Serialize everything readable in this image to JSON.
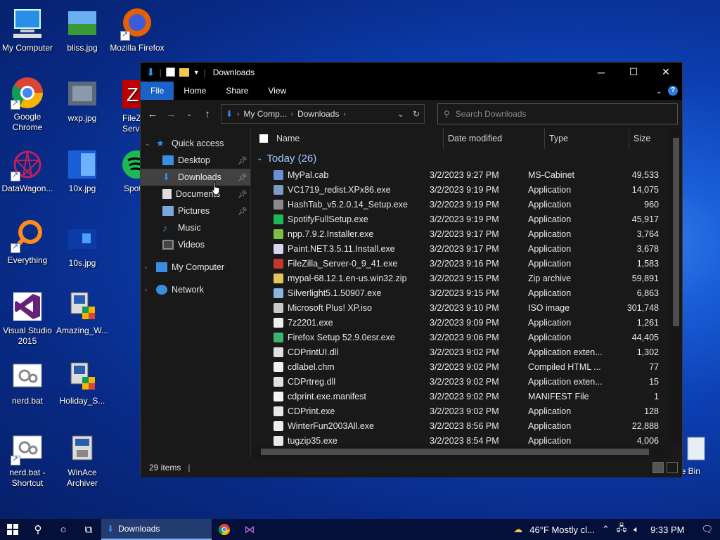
{
  "desktop": {
    "icons": [
      {
        "label": "My Computer",
        "icon": "computer-icon"
      },
      {
        "label": "bliss.jpg",
        "icon": "image-icon"
      },
      {
        "label": "Mozilla Firefox",
        "icon": "firefox-icon"
      },
      {
        "label": "Google Chrome",
        "icon": "chrome-icon"
      },
      {
        "label": "wxp.jpg",
        "icon": "image-icon"
      },
      {
        "label": "FileZ Serve",
        "icon": "filezilla-icon"
      },
      {
        "label": "DataWagon...",
        "icon": "datawagon-icon"
      },
      {
        "label": "10x.jpg",
        "icon": "image-icon"
      },
      {
        "label": "Spoti",
        "icon": "spotify-icon"
      },
      {
        "label": "Everything",
        "icon": "search-icon"
      },
      {
        "label": "10s.jpg",
        "icon": "image-icon"
      },
      {
        "label": "Visual Studio 2015",
        "icon": "visual-studio-icon"
      },
      {
        "label": "Amazing_W...",
        "icon": "installer-icon"
      },
      {
        "label": "nerd.bat",
        "icon": "gear-icon"
      },
      {
        "label": "Holiday_S...",
        "icon": "installer-icon"
      },
      {
        "label": "nerd.bat - Shortcut",
        "icon": "gear-icon"
      },
      {
        "label": "WinAce Archiver",
        "icon": "archiver-icon"
      },
      {
        "label": "cle Bin",
        "icon": "recycle-bin-icon"
      }
    ]
  },
  "window": {
    "title": "Downloads",
    "ribbon_tabs": [
      "File",
      "Home",
      "Share",
      "View"
    ],
    "breadcrumb": [
      "My Comp...",
      "Downloads"
    ],
    "search_placeholder": "Search Downloads",
    "nav": {
      "quick_access": "Quick access",
      "items": [
        "Desktop",
        "Downloads",
        "Documents",
        "Pictures",
        "Music",
        "Videos"
      ],
      "my_computer": "My Computer",
      "network": "Network"
    },
    "columns": [
      "Name",
      "Date modified",
      "Type",
      "Size"
    ],
    "group_label": "Today (26)",
    "files": [
      {
        "name": "MyPal.cab",
        "date": "3/2/2023 9:27 PM",
        "type": "MS-Cabinet",
        "size": "49,533",
        "color": "#6a8fd6"
      },
      {
        "name": "VC1719_redist.XPx86.exe",
        "date": "3/2/2023 9:19 PM",
        "type": "Application",
        "size": "14,075",
        "color": "#7e9bc4"
      },
      {
        "name": "HashTab_v5.2.0.14_Setup.exe",
        "date": "3/2/2023 9:19 PM",
        "type": "Application",
        "size": "960",
        "color": "#8a8a8a"
      },
      {
        "name": "SpotifyFullSetup.exe",
        "date": "3/2/2023 9:19 PM",
        "type": "Application",
        "size": "45,917",
        "color": "#1db954"
      },
      {
        "name": "npp.7.9.2.Installer.exe",
        "date": "3/2/2023 9:17 PM",
        "type": "Application",
        "size": "3,764",
        "color": "#7bc043"
      },
      {
        "name": "Paint.NET.3.5.11.Install.exe",
        "date": "3/2/2023 9:17 PM",
        "type": "Application",
        "size": "3,678",
        "color": "#d6d6f0"
      },
      {
        "name": "FileZilla_Server-0_9_41.exe",
        "date": "3/2/2023 9:16 PM",
        "type": "Application",
        "size": "1,583",
        "color": "#c0392b"
      },
      {
        "name": "mypal-68.12.1.en-us.win32.zip",
        "date": "3/2/2023 9:15 PM",
        "type": "Zip archive",
        "size": "59,891",
        "color": "#e6c35c"
      },
      {
        "name": "Silverlight5.1.50907.exe",
        "date": "3/2/2023 9:15 PM",
        "type": "Application",
        "size": "6,863",
        "color": "#8fb3e0"
      },
      {
        "name": "Microsoft Plus! XP.iso",
        "date": "3/2/2023 9:10 PM",
        "type": "ISO image",
        "size": "301,748",
        "color": "#c8c8c8"
      },
      {
        "name": "7z2201.exe",
        "date": "3/2/2023 9:09 PM",
        "type": "Application",
        "size": "1,261",
        "color": "#eeeeee"
      },
      {
        "name": "Firefox Setup 52.9.0esr.exe",
        "date": "3/2/2023 9:06 PM",
        "type": "Application",
        "size": "44,405",
        "color": "#3cb371"
      },
      {
        "name": "CDPrintUI.dll",
        "date": "3/2/2023 9:02 PM",
        "type": "Application exten...",
        "size": "1,302",
        "color": "#e0e0e0"
      },
      {
        "name": "cdlabel.chm",
        "date": "3/2/2023 9:02 PM",
        "type": "Compiled HTML ...",
        "size": "77",
        "color": "#f0f0f0"
      },
      {
        "name": "CDPrtreg.dll",
        "date": "3/2/2023 9:02 PM",
        "type": "Application exten...",
        "size": "15",
        "color": "#e0e0e0"
      },
      {
        "name": "cdprint.exe.manifest",
        "date": "3/2/2023 9:02 PM",
        "type": "MANIFEST File",
        "size": "1",
        "color": "#f5f5f5"
      },
      {
        "name": "CDPrint.exe",
        "date": "3/2/2023 9:02 PM",
        "type": "Application",
        "size": "128",
        "color": "#e8e8e8"
      },
      {
        "name": "WinterFun2003All.exe",
        "date": "3/2/2023 8:56 PM",
        "type": "Application",
        "size": "22,888",
        "color": "#eeeeee"
      },
      {
        "name": "tugzip35.exe",
        "date": "3/2/2023 8:54 PM",
        "type": "Application",
        "size": "4,006",
        "color": "#e8e8e8"
      }
    ],
    "status": "29 items"
  },
  "taskbar": {
    "active_app": "Downloads",
    "weather": "46°F  Mostly cl...",
    "time": "9:33 PM"
  }
}
